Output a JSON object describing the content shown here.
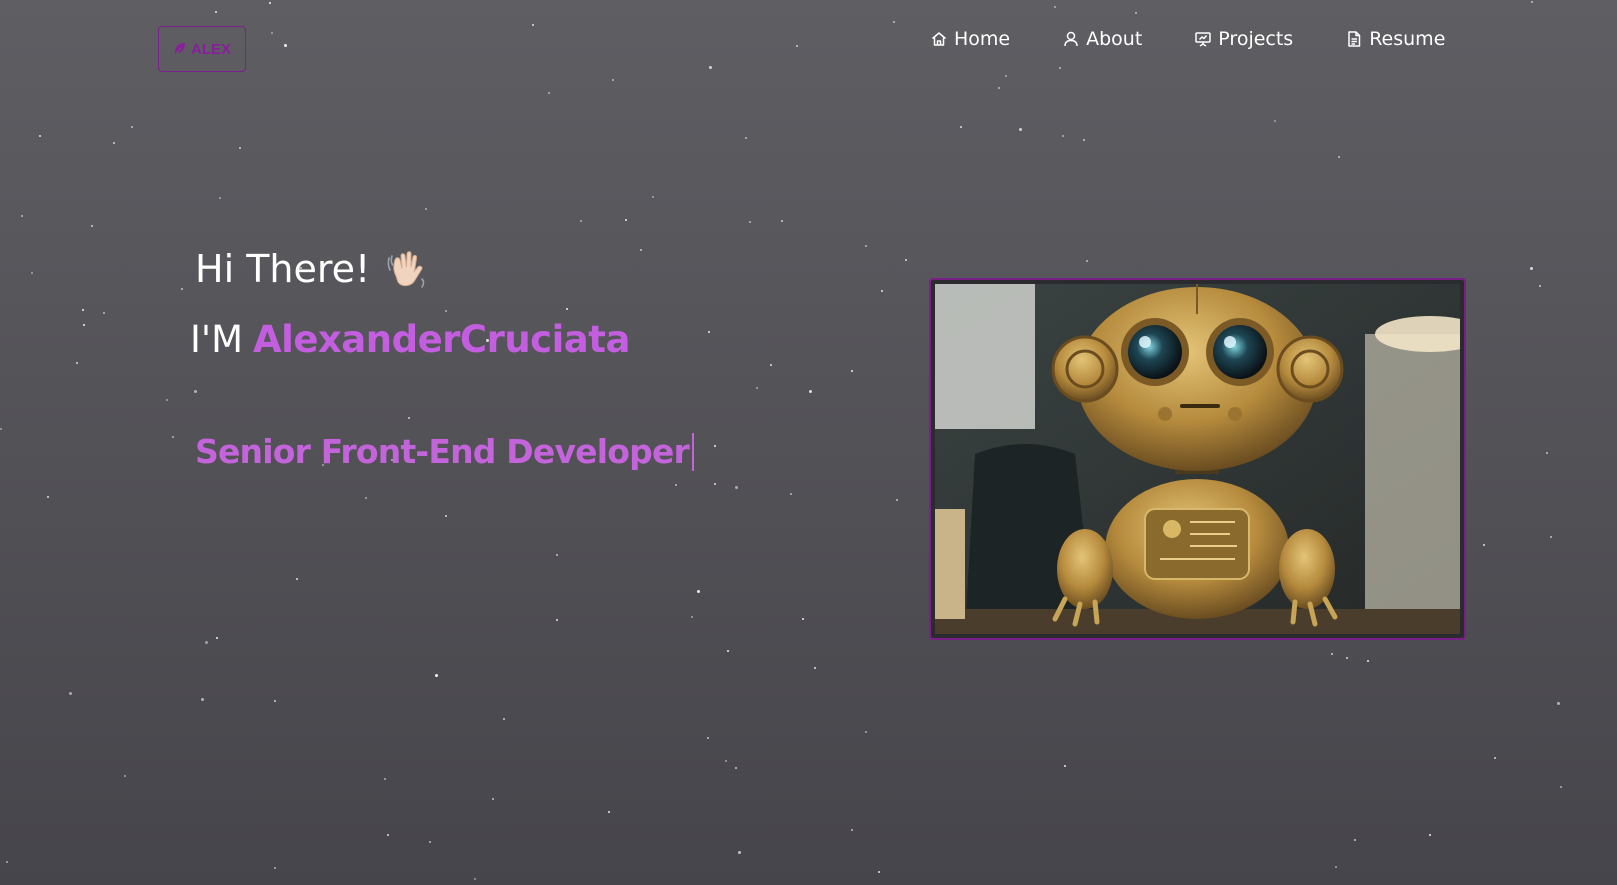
{
  "logo": {
    "text": "ALEX",
    "icon": "feather-icon",
    "color": "#8b1c9e"
  },
  "nav": {
    "items": [
      {
        "label": "Home",
        "icon": "home-icon"
      },
      {
        "label": "About",
        "icon": "user-icon"
      },
      {
        "label": "Projects",
        "icon": "presentation-icon"
      },
      {
        "label": "Resume",
        "icon": "document-icon"
      }
    ]
  },
  "hero": {
    "greeting": "Hi There!",
    "greeting_emoji": "waving-hand-icon",
    "name_prefix": "I'M",
    "name": "AlexanderCruciata",
    "role": "Senior Front-End Developer",
    "image": "robot-illustration",
    "accent_color": "#c35ee0"
  },
  "background": {
    "gradient_top": "#5e5e63",
    "gradient_bottom": "#46454b"
  }
}
